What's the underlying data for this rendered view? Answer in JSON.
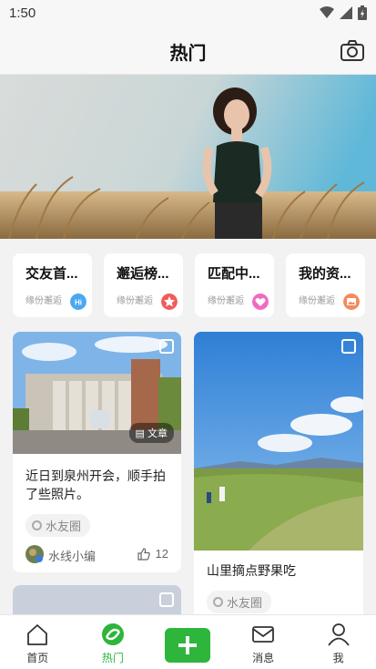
{
  "status": {
    "time": "1:50"
  },
  "header": {
    "title": "热门"
  },
  "categories": [
    {
      "title": "交友首...",
      "subtitle": "缘份邂逅",
      "badge": "Hi"
    },
    {
      "title": "邂逅榜...",
      "subtitle": "缘份邂逅",
      "badge": ""
    },
    {
      "title": "匹配中...",
      "subtitle": "缘份邂逅",
      "badge": ""
    },
    {
      "title": "我的资...",
      "subtitle": "缘份邂逅",
      "badge": ""
    }
  ],
  "feed": {
    "left": [
      {
        "tag": "文章",
        "text": "近日到泉州开会，顺手拍了些照片。",
        "circle": "水友圈",
        "author": "水线小编",
        "likes": "12"
      }
    ],
    "right": [
      {
        "text": "山里摘点野果吃",
        "circle": "水友圈"
      }
    ]
  },
  "tabbar": {
    "home": "首页",
    "hot": "热门",
    "messages": "消息",
    "me": "我"
  },
  "colors": {
    "accent": "#2db53c"
  }
}
